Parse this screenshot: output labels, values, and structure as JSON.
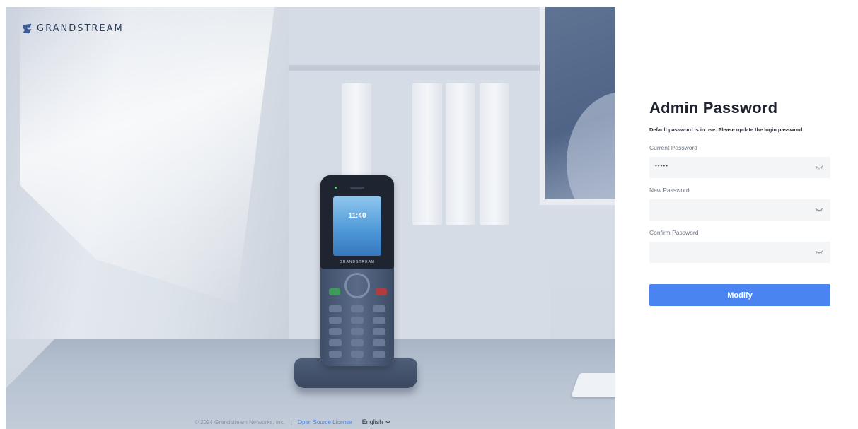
{
  "brand": {
    "name": "GRANDSTREAM",
    "mark_color": "#3a5a9a"
  },
  "hero": {
    "phone_time": "11:40",
    "phone_brand": "GRANDSTREAM"
  },
  "footer": {
    "copyright": "© 2024 Grandstream Networks, Inc.",
    "separator": "|",
    "open_source_link": "Open Source License",
    "language": "English"
  },
  "form": {
    "title": "Admin Password",
    "subtitle": "Default password is in use. Please update the login password.",
    "fields": [
      {
        "label": "Current Password",
        "value": "•••••"
      },
      {
        "label": "New Password",
        "value": ""
      },
      {
        "label": "Confirm Password",
        "value": ""
      }
    ],
    "submit_label": "Modify",
    "accent_color": "#4a84f0"
  }
}
